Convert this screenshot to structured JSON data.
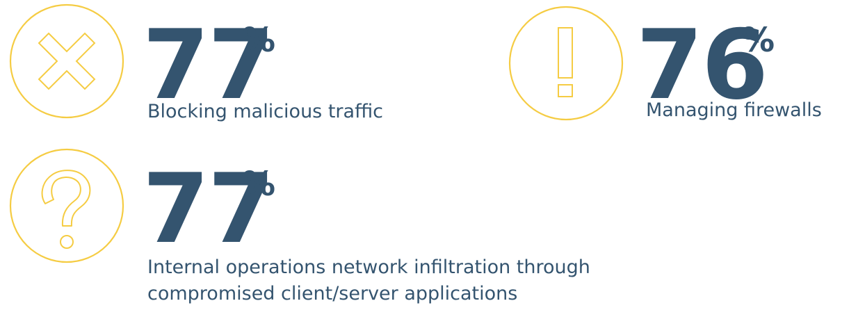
{
  "colors": {
    "accent": "#f5cc43",
    "text": "#34546f",
    "background": "#ffffff"
  },
  "stats": [
    {
      "icon": "x-icon",
      "value": "77",
      "unit": "%",
      "label": "Blocking malicious traffic"
    },
    {
      "icon": "exclamation-icon",
      "value": "76",
      "unit": "%",
      "label": "Managing firewalls"
    },
    {
      "icon": "question-icon",
      "value": "77",
      "unit": "%",
      "label_lines": [
        "Internal operations network infiltration through",
        "compromised client/server applications"
      ]
    }
  ]
}
